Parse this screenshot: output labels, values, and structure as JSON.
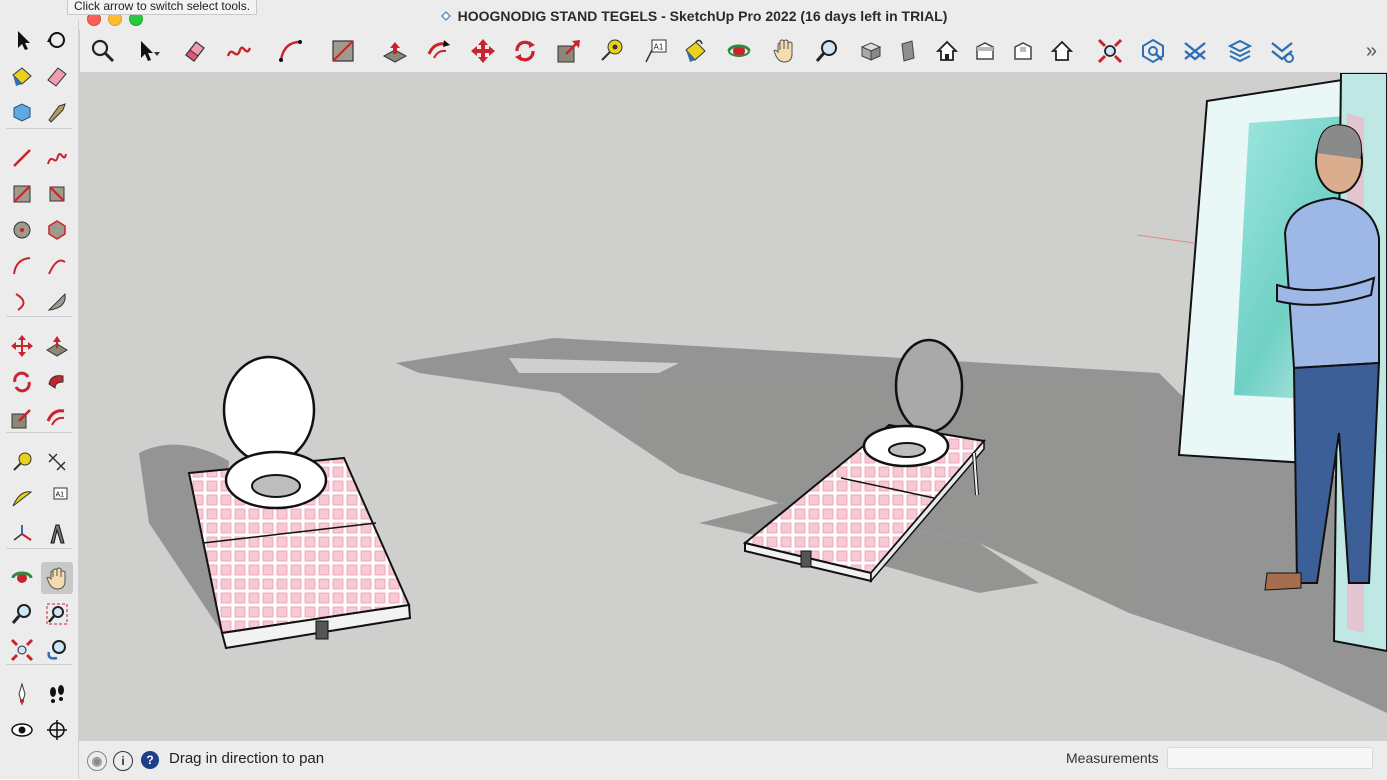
{
  "window": {
    "title": "HOOGNODIG STAND TEGELS - SketchUp Pro 2022 (16 days left in TRIAL)",
    "tooltip": "Click arrow to switch select tools."
  },
  "toolbar": {
    "items": [
      {
        "name": "search-tools-icon"
      },
      {
        "name": "select-icon"
      },
      {
        "name": "eraser-icon"
      },
      {
        "name": "freehand-icon"
      },
      {
        "name": "arc-icon"
      },
      {
        "name": "rectangle-icon"
      },
      {
        "name": "push-pull-icon"
      },
      {
        "name": "offset-icon"
      },
      {
        "name": "move-icon"
      },
      {
        "name": "rotate-icon"
      },
      {
        "name": "scale-icon"
      },
      {
        "name": "tape-measure-icon"
      },
      {
        "name": "text-icon"
      },
      {
        "name": "paint-bucket-icon"
      },
      {
        "name": "orbit-icon"
      },
      {
        "name": "pan-icon"
      },
      {
        "name": "zoom-icon"
      },
      {
        "name": "iso-view-icon"
      },
      {
        "name": "top-view-icon"
      },
      {
        "name": "front-view-icon"
      },
      {
        "name": "right-view-icon"
      },
      {
        "name": "back-view-icon"
      },
      {
        "name": "left-view-icon"
      },
      {
        "name": "zoom-extents-icon"
      },
      {
        "name": "warehouse-icon"
      },
      {
        "name": "extension-warehouse-icon"
      },
      {
        "name": "layout-icon"
      },
      {
        "name": "extension-manager-icon"
      }
    ],
    "overflow_icon": "chevron-right-icon"
  },
  "sidebar": {
    "tools": [
      "select-icon",
      "orbit-icon",
      "paint-bucket-icon",
      "eraser-icon",
      "component-icon",
      "tag-icon",
      "line-icon",
      "freehand-icon",
      "rectangle-icon",
      "rotated-rectangle-icon",
      "circle-icon",
      "polygon-icon",
      "arc-icon",
      "two-point-arc-icon",
      "three-point-arc-icon",
      "pie-icon",
      "move-icon",
      "push-pull-icon",
      "rotate-icon",
      "follow-me-icon",
      "scale-icon",
      "offset-icon",
      "tape-measure-icon",
      "dimension-icon",
      "protractor-icon",
      "text-icon",
      "axes-icon",
      "3d-text-icon",
      "orbit-tool-icon",
      "pan-icon",
      "zoom-icon",
      "zoom-window-icon",
      "zoom-extents-icon",
      "previous-view-icon",
      "position-camera-icon",
      "walk-icon",
      "look-around-icon",
      "section-plane-icon",
      "warehouse-icon",
      "layout-icon"
    ],
    "active_tool": "pan-icon"
  },
  "statusbar": {
    "hint": "Drag in direction to pan",
    "measurements_label": "Measurements",
    "measurements_value": ""
  },
  "scene": {
    "background": "#cfd0cd",
    "tile_color": "#f2b8c6",
    "grout_color": "#ffffff",
    "shadow_color": "#8a8a89"
  }
}
